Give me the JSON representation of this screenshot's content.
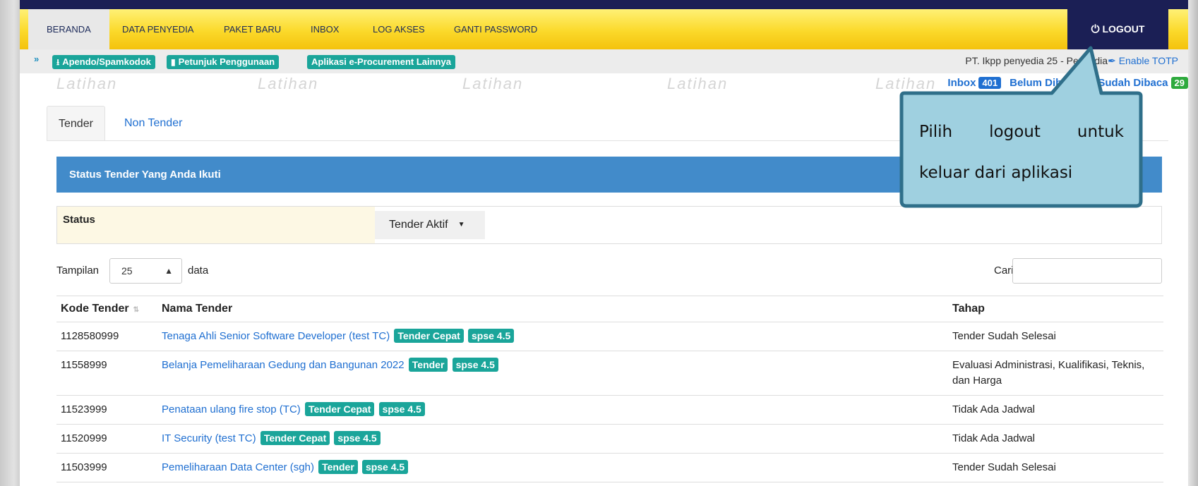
{
  "nav": {
    "items": [
      {
        "label": "BERANDA",
        "active": true
      },
      {
        "label": "DATA PENYEDIA",
        "active": false
      },
      {
        "label": "PAKET BARU",
        "active": false
      },
      {
        "label": "INBOX",
        "active": false
      },
      {
        "label": "LOG AKSES",
        "active": false
      },
      {
        "label": "GANTI PASSWORD",
        "active": false
      }
    ],
    "logout_label": "LOGOUT",
    "logout_icon": "power-icon"
  },
  "subbar": {
    "collapse_icon": "double-chevron-up-icon",
    "buttons": [
      {
        "label": "Apendo/Spamkodok",
        "icon": "download-icon"
      },
      {
        "label": "Petunjuk Penggunaan",
        "icon": "book-icon"
      },
      {
        "label": "Aplikasi e-Procurement Lainnya",
        "icon": ""
      }
    ],
    "company": "PT. Ikpp penyedia 25 - Penyedia",
    "totp_label": "Enable TOTP",
    "totp_icon": "key-icon"
  },
  "watermark": "Latihan",
  "inbox": {
    "inbox_label": "Inbox",
    "inbox_count": "401",
    "unread_label": "Belum Dibaca",
    "unread_count": "",
    "read_label": "Sudah Dibaca",
    "read_count": "29"
  },
  "tabs": [
    {
      "label": "Tender",
      "active": true
    },
    {
      "label": "Non Tender",
      "active": false
    }
  ],
  "panel": {
    "title": "Status Tender Yang Anda Ikuti",
    "status_label": "Status",
    "status_value": "Tender Aktif"
  },
  "controls": {
    "show_label": "Tampilan",
    "page_size": "25",
    "data_label": "data",
    "search_label": "Cari:",
    "search_value": ""
  },
  "table": {
    "columns": [
      "Kode Tender",
      "Nama Tender",
      "Tahap"
    ],
    "rows": [
      {
        "kode": "1128580999",
        "nama": "Tenaga Ahli Senior Software Developer (test TC)",
        "tags": [
          "Tender Cepat",
          "spse 4.5"
        ],
        "tahap": "Tender Sudah Selesai"
      },
      {
        "kode": "11558999",
        "nama": "Belanja Pemeliharaan Gedung dan Bangunan 2022",
        "tags": [
          "Tender",
          "spse 4.5"
        ],
        "tahap": "Evaluasi Administrasi, Kualifikasi, Teknis, dan Harga"
      },
      {
        "kode": "11523999",
        "nama": "Penataan ulang fire stop (TC)",
        "tags": [
          "Tender Cepat",
          "spse 4.5"
        ],
        "tahap": "Tidak Ada Jadwal"
      },
      {
        "kode": "11520999",
        "nama": "IT Security (test TC)",
        "tags": [
          "Tender Cepat",
          "spse 4.5"
        ],
        "tahap": "Tidak Ada Jadwal"
      },
      {
        "kode": "11503999",
        "nama": "Pemeliharaan Data Center (sgh)",
        "tags": [
          "Tender",
          "spse 4.5"
        ],
        "tahap": "Tender Sudah Selesai"
      }
    ]
  },
  "callout": {
    "line1": [
      "Pilih",
      "logout",
      "untuk"
    ],
    "line2": "keluar dari aplikasi"
  },
  "colors": {
    "navbar": "#fbd92a",
    "logout_bg": "#1b1f55",
    "accent_teal": "#1aa59a",
    "panel_blue": "#428bca",
    "link_blue": "#1f6fd1",
    "callout_fill": "#9fd0e0",
    "callout_border": "#2f6f8a"
  }
}
